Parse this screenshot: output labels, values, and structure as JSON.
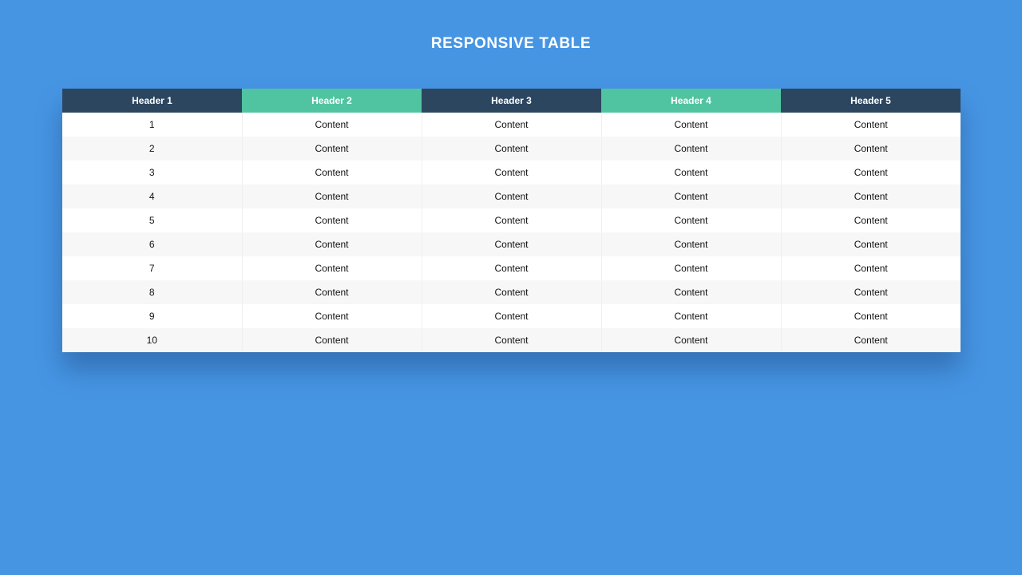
{
  "page": {
    "title": "RESPONSIVE TABLE"
  },
  "colors": {
    "background": "#4695e3",
    "header_dark": "#2c4660",
    "header_green": "#50c4a0",
    "row_odd": "#ffffff",
    "row_even": "#f7f7f7"
  },
  "table": {
    "headers": [
      "Header 1",
      "Header 2",
      "Header 3",
      "Header 4",
      "Header 5"
    ],
    "rows": [
      [
        "1",
        "Content",
        "Content",
        "Content",
        "Content"
      ],
      [
        "2",
        "Content",
        "Content",
        "Content",
        "Content"
      ],
      [
        "3",
        "Content",
        "Content",
        "Content",
        "Content"
      ],
      [
        "4",
        "Content",
        "Content",
        "Content",
        "Content"
      ],
      [
        "5",
        "Content",
        "Content",
        "Content",
        "Content"
      ],
      [
        "6",
        "Content",
        "Content",
        "Content",
        "Content"
      ],
      [
        "7",
        "Content",
        "Content",
        "Content",
        "Content"
      ],
      [
        "8",
        "Content",
        "Content",
        "Content",
        "Content"
      ],
      [
        "9",
        "Content",
        "Content",
        "Content",
        "Content"
      ],
      [
        "10",
        "Content",
        "Content",
        "Content",
        "Content"
      ]
    ]
  }
}
